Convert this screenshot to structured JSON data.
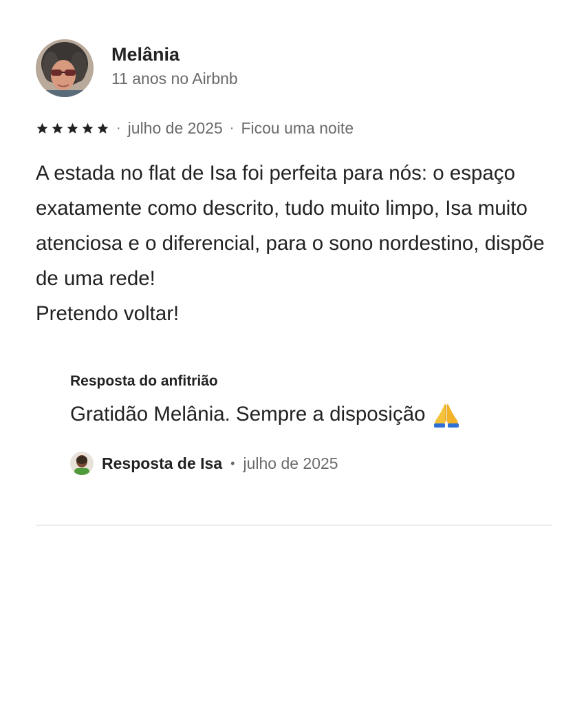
{
  "reviewer": {
    "name": "Melânia",
    "tenure": "11 anos no Airbnb",
    "avatar_icon": "reviewer-photo"
  },
  "review": {
    "rating": 5,
    "rating_max": 5,
    "date": "julho de 2025",
    "stay": "Ficou uma noite",
    "separator": "·",
    "text": "A estada no flat de Isa foi perfeita para nós: o espaço exatamente como descrito, tudo muito limpo, Isa muito atenciosa e o diferencial, para o sono nordestino, dispõe de uma rede!\nPretendo voltar!"
  },
  "host_response": {
    "title": "Resposta do anfitrião",
    "text": "Gratidão Melânia. Sempre a disposição",
    "emoji_icon": "praying-hands-icon",
    "author_label": "Resposta de Isa",
    "separator": "•",
    "date": "julho de 2025"
  },
  "colors": {
    "primary_text": "#222222",
    "secondary_text": "#6a6a6a",
    "divider": "#ebebeb"
  }
}
